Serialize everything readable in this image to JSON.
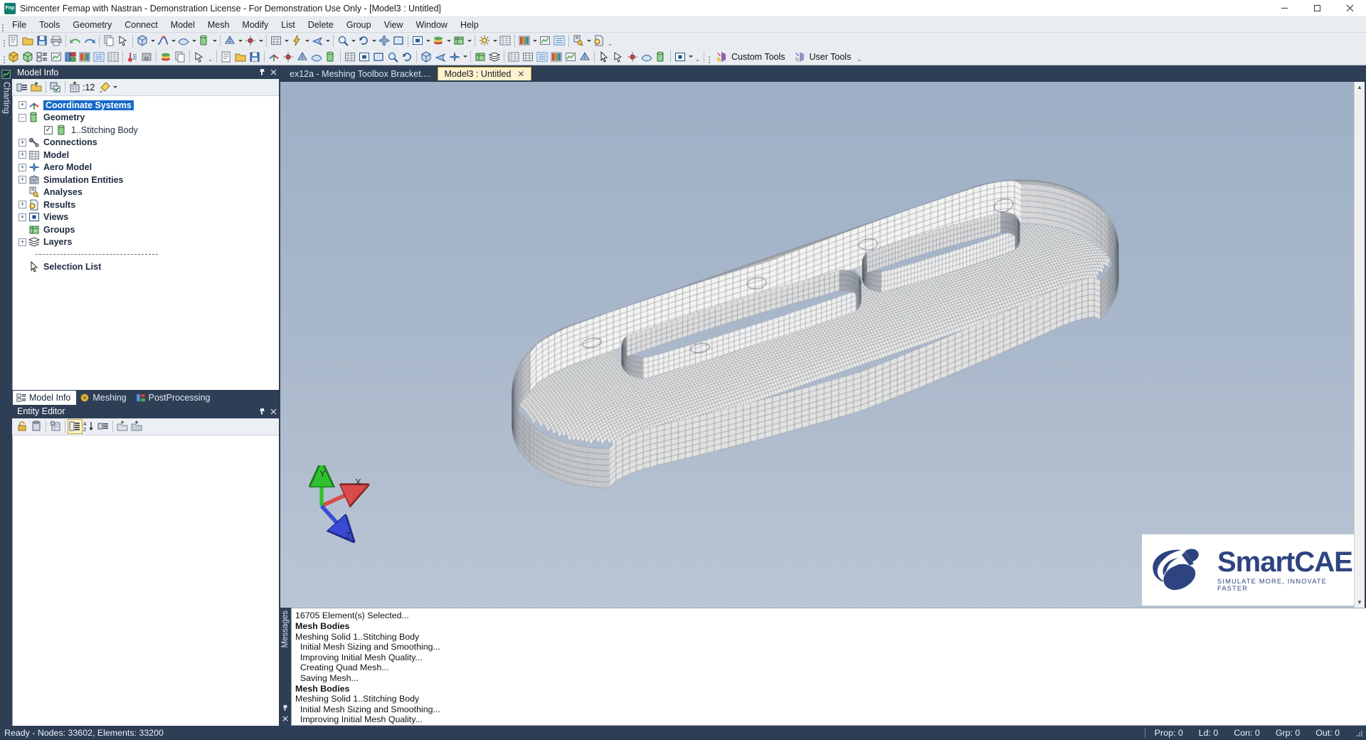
{
  "titlebar": {
    "app_icon": "femap-icon",
    "title": "Simcenter Femap with Nastran - Demonstration License - For Demonstration Use Only - [Model3 : Untitled]",
    "minimize": "minimize-button",
    "maximize": "maximize-button",
    "close": "close-button"
  },
  "menubar": {
    "items": [
      {
        "label": "File"
      },
      {
        "label": "Tools"
      },
      {
        "label": "Geometry"
      },
      {
        "label": "Connect"
      },
      {
        "label": "Model"
      },
      {
        "label": "Mesh"
      },
      {
        "label": "Modify"
      },
      {
        "label": "List"
      },
      {
        "label": "Delete"
      },
      {
        "label": "Group"
      },
      {
        "label": "View"
      },
      {
        "label": "Window"
      },
      {
        "label": "Help"
      }
    ]
  },
  "toolbar": {
    "custom_tools_label": "Custom Tools",
    "user_tools_label": "User Tools"
  },
  "model_info": {
    "title": "Model Info",
    "counter": ":12",
    "pin": "pin-button",
    "close": "close-button",
    "tree": [
      {
        "label": "Coordinate Systems",
        "icon": "coordinate-systems-icon",
        "expander": "+",
        "selected": true,
        "indent": 0
      },
      {
        "label": "Geometry",
        "icon": "geometry-icon",
        "expander": "-",
        "selected": false,
        "indent": 0
      },
      {
        "label": "1..Stitching Body",
        "icon": "solid-body-icon",
        "expander": "none",
        "selected": false,
        "indent": 1,
        "checkbox": true
      },
      {
        "label": "Connections",
        "icon": "connections-icon",
        "expander": "+",
        "selected": false,
        "indent": 0
      },
      {
        "label": "Model",
        "icon": "model-icon",
        "expander": "+",
        "selected": false,
        "indent": 0
      },
      {
        "label": "Aero Model",
        "icon": "aero-model-icon",
        "expander": "+",
        "selected": false,
        "indent": 0
      },
      {
        "label": "Simulation Entities",
        "icon": "simulation-entities-icon",
        "expander": "+",
        "selected": false,
        "indent": 0
      },
      {
        "label": "Analyses",
        "icon": "analyses-icon",
        "expander": "none",
        "selected": false,
        "indent": 0
      },
      {
        "label": "Results",
        "icon": "results-icon",
        "expander": "+",
        "selected": false,
        "indent": 0
      },
      {
        "label": "Views",
        "icon": "views-icon",
        "expander": "+",
        "selected": false,
        "indent": 0
      },
      {
        "label": "Groups",
        "icon": "groups-icon",
        "expander": "none",
        "selected": false,
        "indent": 0
      },
      {
        "label": "Layers",
        "icon": "layers-icon",
        "expander": "+",
        "selected": false,
        "indent": 0
      },
      {
        "label": "Selection List",
        "icon": "selection-list-icon",
        "expander": "none",
        "selected": false,
        "indent": 0,
        "after_divider": true
      }
    ]
  },
  "dock_tabs": [
    {
      "label": "Model Info",
      "icon": "model-info-icon",
      "active": true
    },
    {
      "label": "Meshing",
      "icon": "meshing-icon",
      "active": false
    },
    {
      "label": "PostProcessing",
      "icon": "postprocessing-icon",
      "active": false
    }
  ],
  "entity_editor": {
    "title": "Entity Editor",
    "pin": "pin-button",
    "close": "close-button"
  },
  "charting_strip": {
    "label": "Charting"
  },
  "document_tabs": [
    {
      "label": "ex12a - Meshing Toolbox Bracket....",
      "active": false,
      "closable": false
    },
    {
      "label": "Model3 : Untitled",
      "active": true,
      "closable": true,
      "close": "×"
    }
  ],
  "viewport": {
    "triad": {
      "x_label": "X",
      "y_label": "Y",
      "z_label": "Z",
      "x_color": "#d94a4a",
      "y_color": "#2fc22f",
      "z_color": "#3a4ad6"
    },
    "bg_top": "#9fb0c6",
    "bg_bottom": "#b9c5d4",
    "model_description": "meshed bracket solid, quad shell mesh"
  },
  "logo": {
    "name": "SmartCAE",
    "tagline": "SIMULATE MORE, INNOVATE FASTER",
    "color": "#2d4480"
  },
  "messages": {
    "strip_label": "Messages",
    "pin": "pin-button",
    "close": "close-button",
    "lines": [
      {
        "text": "16705 Element(s) Selected...",
        "bold": false
      },
      {
        "text": "Mesh Bodies",
        "bold": true
      },
      {
        "text": "Meshing Solid 1..Stitching Body",
        "bold": false
      },
      {
        "text": "  Initial Mesh Sizing and Smoothing...",
        "bold": false
      },
      {
        "text": "  Improving Initial Mesh Quality...",
        "bold": false
      },
      {
        "text": "  Creating Quad Mesh...",
        "bold": false
      },
      {
        "text": "  Saving Mesh...",
        "bold": false
      },
      {
        "text": "Mesh Bodies",
        "bold": true
      },
      {
        "text": "Meshing Solid 1..Stitching Body",
        "bold": false
      },
      {
        "text": "  Initial Mesh Sizing and Smoothing...",
        "bold": false
      },
      {
        "text": "  Improving Initial Mesh Quality...",
        "bold": false
      }
    ]
  },
  "statusbar": {
    "message": "Ready - Nodes: 33602,  Elements: 33200",
    "counters": [
      {
        "label": "Prop: 0"
      },
      {
        "label": "Ld: 0"
      },
      {
        "label": "Con: 0"
      },
      {
        "label": "Grp: 0"
      },
      {
        "label": "Out: 0"
      }
    ],
    "resize_grip": "resize-grip"
  }
}
